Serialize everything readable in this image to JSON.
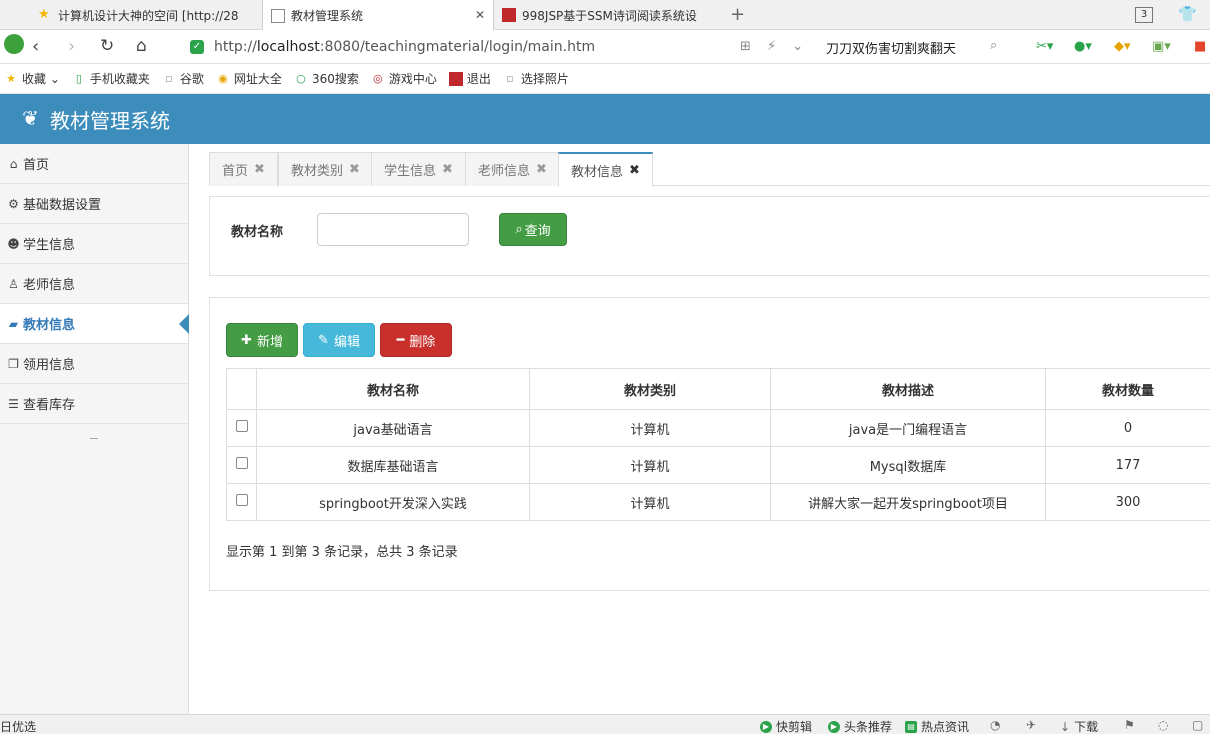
{
  "browser": {
    "tabs": [
      {
        "label": "计算机设计大神的空间 [http://28",
        "active": false
      },
      {
        "label": "教材管理系统",
        "active": true
      },
      {
        "label": "998JSP基于SSM诗词阅读系统设",
        "active": false
      }
    ],
    "tab_count": "3",
    "url_prefix": "http://",
    "url_host": "localhost",
    "url_rest": ":8080/teachingmaterial/login/main.htm",
    "search_text": "刀刀双伤害切割爽翻天",
    "bookmarks": [
      "收藏",
      "手机收藏夹",
      "谷歌",
      "网址大全",
      "360搜索",
      "游戏中心",
      "退出",
      "选择照片"
    ],
    "status_left": "日优选",
    "status_items": [
      "快剪辑",
      "头条推荐",
      "热点资讯",
      "下载"
    ]
  },
  "app": {
    "title": "教材管理系统"
  },
  "sidebar": {
    "items": [
      {
        "label": "首页",
        "icon": "home-icon"
      },
      {
        "label": "基础数据设置",
        "icon": "gear-icon"
      },
      {
        "label": "学生信息",
        "icon": "users-icon"
      },
      {
        "label": "老师信息",
        "icon": "user-icon"
      },
      {
        "label": "教材信息",
        "icon": "book-icon",
        "active": true
      },
      {
        "label": "领用信息",
        "icon": "window-icon"
      },
      {
        "label": "查看库存",
        "icon": "list-icon"
      }
    ]
  },
  "content_tabs": [
    {
      "label": "首页"
    },
    {
      "label": "教材类别"
    },
    {
      "label": "学生信息"
    },
    {
      "label": "老师信息"
    },
    {
      "label": "教材信息",
      "active": true
    }
  ],
  "search": {
    "label": "教材名称",
    "value": "",
    "button": "查询"
  },
  "actions": {
    "add": "新增",
    "edit": "编辑",
    "delete": "删除"
  },
  "table": {
    "headers": [
      "教材名称",
      "教材类别",
      "教材描述",
      "教材数量"
    ],
    "rows": [
      {
        "name": "java基础语言",
        "category": "计算机",
        "desc": "java是一门编程语言",
        "qty": "0"
      },
      {
        "name": "数据库基础语言",
        "category": "计算机",
        "desc": "Mysql数据库",
        "qty": "177"
      },
      {
        "name": "springboot开发深入实践",
        "category": "计算机",
        "desc": "讲解大家一起开发springboot项目",
        "qty": "300"
      }
    ]
  },
  "pagination": {
    "info": "显示第 1 到第 3 条记录，总共 3 条记录"
  },
  "colors": {
    "header": "#3c8dbc",
    "success": "#449d44",
    "info": "#46b8da",
    "danger": "#c9302c"
  }
}
